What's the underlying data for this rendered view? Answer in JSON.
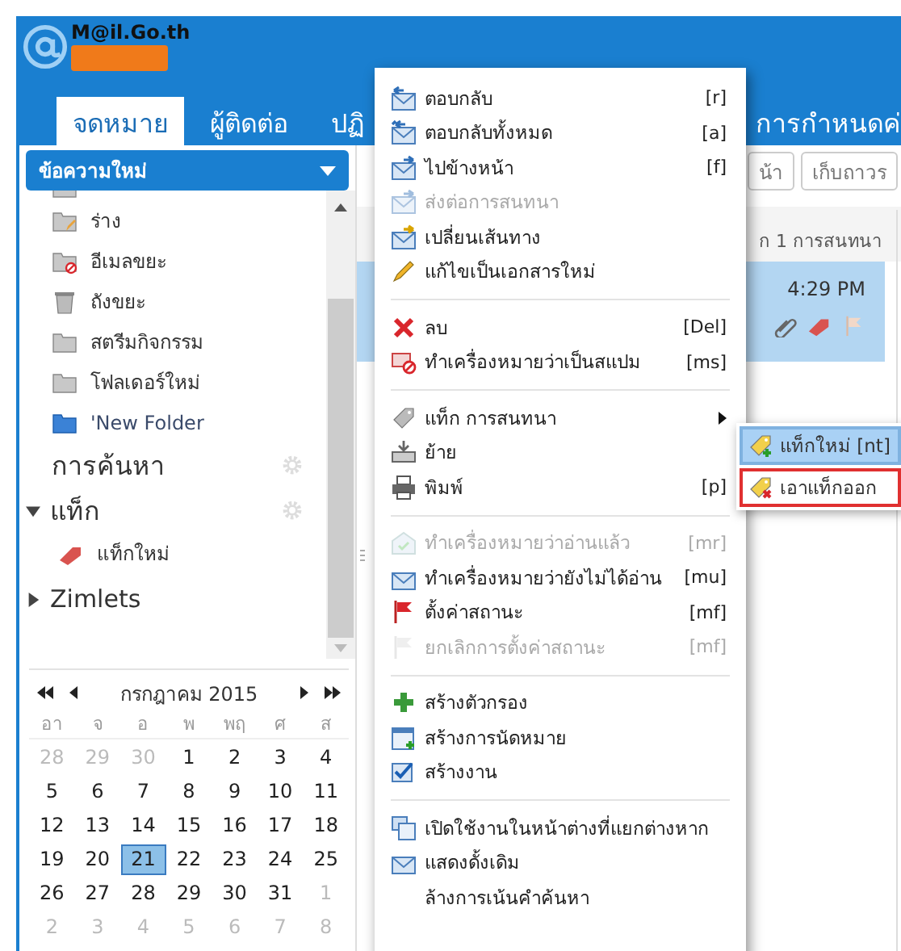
{
  "header": {
    "logo_text": "M@il.Go.th",
    "tabs": [
      {
        "label": "จดหมาย",
        "selected": true
      },
      {
        "label": "ผู้ติดต่อ",
        "selected": false
      },
      {
        "label": "ปฏิ",
        "selected": false
      },
      {
        "label": "การกำหนดค่",
        "selected": false
      }
    ]
  },
  "sidebar": {
    "new_button": "ข้อความใหม่",
    "folders": [
      {
        "name": "ร่าง"
      },
      {
        "name": "อีเมลขยะ"
      },
      {
        "name": "ถังขยะ"
      },
      {
        "name": "สตรีมกิจกรรม"
      },
      {
        "name": "โฟลเดอร์ใหม่"
      },
      {
        "name": "'New Folder"
      }
    ],
    "searches": {
      "label": "การค้นหา"
    },
    "tags": {
      "label": "แท็ก",
      "expanded": true,
      "items": [
        {
          "name": "แท็กใหม่",
          "color": "#d9534f"
        }
      ]
    },
    "zimlets": {
      "label": "Zimlets",
      "expanded": false
    }
  },
  "calendar": {
    "month": "กรกฎาคม 2015",
    "weekdays": [
      "อา",
      "จ",
      "อ",
      "พ",
      "พฤ",
      "ศ",
      "ส"
    ],
    "weeks": [
      [
        {
          "day": "28",
          "other": true,
          "selected": false
        },
        {
          "day": "29",
          "other": true,
          "selected": false
        },
        {
          "day": "30",
          "other": true,
          "selected": false
        },
        {
          "day": "1",
          "other": false,
          "selected": false
        },
        {
          "day": "2",
          "other": false,
          "selected": false
        },
        {
          "day": "3",
          "other": false,
          "selected": false
        },
        {
          "day": "4",
          "other": false,
          "selected": false
        }
      ],
      [
        {
          "day": "5",
          "other": false,
          "selected": false
        },
        {
          "day": "6",
          "other": false,
          "selected": false
        },
        {
          "day": "7",
          "other": false,
          "selected": false
        },
        {
          "day": "8",
          "other": false,
          "selected": false
        },
        {
          "day": "9",
          "other": false,
          "selected": false
        },
        {
          "day": "10",
          "other": false,
          "selected": false
        },
        {
          "day": "11",
          "other": false,
          "selected": false
        }
      ],
      [
        {
          "day": "12",
          "other": false,
          "selected": false
        },
        {
          "day": "13",
          "other": false,
          "selected": false
        },
        {
          "day": "14",
          "other": false,
          "selected": false
        },
        {
          "day": "15",
          "other": false,
          "selected": false
        },
        {
          "day": "16",
          "other": false,
          "selected": false
        },
        {
          "day": "17",
          "other": false,
          "selected": false
        },
        {
          "day": "18",
          "other": false,
          "selected": false
        }
      ],
      [
        {
          "day": "19",
          "other": false,
          "selected": false
        },
        {
          "day": "20",
          "other": false,
          "selected": false
        },
        {
          "day": "21",
          "other": false,
          "selected": true
        },
        {
          "day": "22",
          "other": false,
          "selected": false
        },
        {
          "day": "23",
          "other": false,
          "selected": false
        },
        {
          "day": "24",
          "other": false,
          "selected": false
        },
        {
          "day": "25",
          "other": false,
          "selected": false
        }
      ],
      [
        {
          "day": "26",
          "other": false,
          "selected": false
        },
        {
          "day": "27",
          "other": false,
          "selected": false
        },
        {
          "day": "28",
          "other": false,
          "selected": false
        },
        {
          "day": "29",
          "other": false,
          "selected": false
        },
        {
          "day": "30",
          "other": false,
          "selected": false
        },
        {
          "day": "31",
          "other": false,
          "selected": false
        },
        {
          "day": "1",
          "other": true,
          "selected": false
        }
      ],
      [
        {
          "day": "2",
          "other": true,
          "selected": false
        },
        {
          "day": "3",
          "other": true,
          "selected": false
        },
        {
          "day": "4",
          "other": true,
          "selected": false
        },
        {
          "day": "5",
          "other": true,
          "selected": false
        },
        {
          "day": "6",
          "other": true,
          "selected": false
        },
        {
          "day": "7",
          "other": true,
          "selected": false
        },
        {
          "day": "8",
          "other": true,
          "selected": false
        }
      ]
    ]
  },
  "message_list": {
    "toolbar": [
      "น้า",
      "เก็บถาวร"
    ],
    "header": "ก 1 การสนทนา",
    "rows": [
      {
        "time": "4:29 PM",
        "selected": true,
        "attachment": true,
        "tagged": true,
        "flagged": false
      }
    ]
  },
  "context_menu": {
    "items": [
      {
        "kind": "item",
        "label": "ตอบกลับ",
        "shortcut": "[r]",
        "disabled": false
      },
      {
        "kind": "item",
        "label": "ตอบกลับทั้งหมด",
        "shortcut": "[a]",
        "disabled": false
      },
      {
        "kind": "item",
        "label": "ไปข้างหน้า",
        "shortcut": "[f]",
        "disabled": false
      },
      {
        "kind": "item",
        "label": "ส่งต่อการสนทนา",
        "disabled": true
      },
      {
        "kind": "item",
        "label": "เปลี่ยนเส้นทาง",
        "disabled": false
      },
      {
        "kind": "item",
        "label": "แก้ไขเป็นเอกสารใหม่",
        "disabled": false
      },
      {
        "kind": "separator"
      },
      {
        "kind": "item",
        "label": "ลบ",
        "shortcut": "[Del]",
        "disabled": false
      },
      {
        "kind": "item",
        "label": "ทำเครื่องหมายว่าเป็นสแปม",
        "shortcut": "[ms]",
        "disabled": false
      },
      {
        "kind": "separator"
      },
      {
        "kind": "item",
        "label": "แท็ก การสนทนา",
        "disabled": false,
        "submenu": true
      },
      {
        "kind": "item",
        "label": "ย้าย",
        "disabled": false
      },
      {
        "kind": "item",
        "label": "พิมพ์",
        "shortcut": "[p]",
        "disabled": false
      },
      {
        "kind": "separator"
      },
      {
        "kind": "item",
        "label": "ทำเครื่องหมายว่าอ่านแล้ว",
        "shortcut": "[mr]",
        "disabled": true
      },
      {
        "kind": "item",
        "label": "ทำเครื่องหมายว่ายังไม่ได้อ่าน",
        "shortcut": "[mu]",
        "disabled": false
      },
      {
        "kind": "item",
        "label": "ตั้งค่าสถานะ",
        "shortcut": "[mf]",
        "disabled": false
      },
      {
        "kind": "item",
        "label": "ยกเลิกการตั้งค่าสถานะ",
        "shortcut": "[mf]",
        "disabled": true
      },
      {
        "kind": "separator"
      },
      {
        "kind": "item",
        "label": "สร้างตัวกรอง",
        "disabled": false
      },
      {
        "kind": "item",
        "label": "สร้างการนัดหมาย",
        "disabled": false
      },
      {
        "kind": "item",
        "label": "สร้างงาน",
        "disabled": false
      },
      {
        "kind": "separator"
      },
      {
        "kind": "item",
        "label": "เปิดใช้งานในหน้าต่างที่แยกต่างหาก",
        "disabled": false
      },
      {
        "kind": "item",
        "label": "แสดงดั้งเดิม",
        "disabled": false
      },
      {
        "kind": "item",
        "label": "ล้างการเน้นคำค้นหา",
        "disabled": false
      }
    ]
  },
  "submenu": {
    "items": [
      {
        "label": "แท็กใหม่ [nt]",
        "selected": true,
        "outlined": false
      },
      {
        "label": "เอาแท็กออก",
        "selected": false,
        "outlined": true
      }
    ]
  }
}
